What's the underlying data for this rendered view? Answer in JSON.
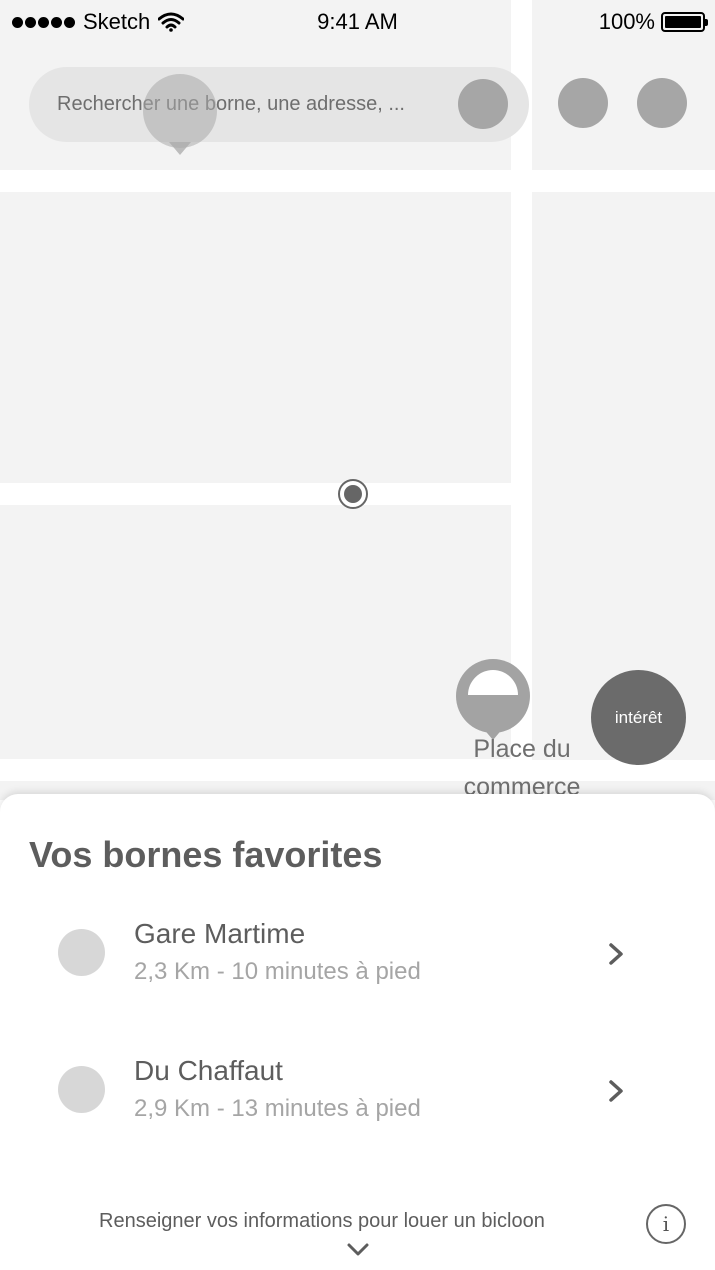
{
  "status_bar": {
    "carrier": "Sketch",
    "time": "9:41 AM",
    "battery": "100%"
  },
  "search": {
    "placeholder": "Rechercher une borne, une adresse, ..."
  },
  "map": {
    "place_label": "Place du\ncommerce",
    "interest_button": "intérêt"
  },
  "sheet": {
    "title": "Vos bornes favorites",
    "favorites": [
      {
        "name": "Gare Martime",
        "distance": "2,3 Km - 10 minutes à pied"
      },
      {
        "name": "Du Chaffaut",
        "distance": "2,9 Km - 13 minutes à pied"
      }
    ],
    "footer_text": "Renseigner vos informations pour louer un bicloon",
    "info_icon_glyph": "i"
  },
  "colors": {
    "map_block": "#f3f3f3",
    "pin": "#a3a3a3",
    "interest_button": "#6b6b6b",
    "text_primary": "#5d5d5d",
    "text_secondary": "#a5a5a5"
  },
  "icons": [
    "signal-dots-icon",
    "wifi-icon",
    "battery-icon",
    "search-icon",
    "map-pin-icon",
    "location-dot-icon",
    "chevron-right-icon",
    "info-icon",
    "chevron-down-icon"
  ]
}
